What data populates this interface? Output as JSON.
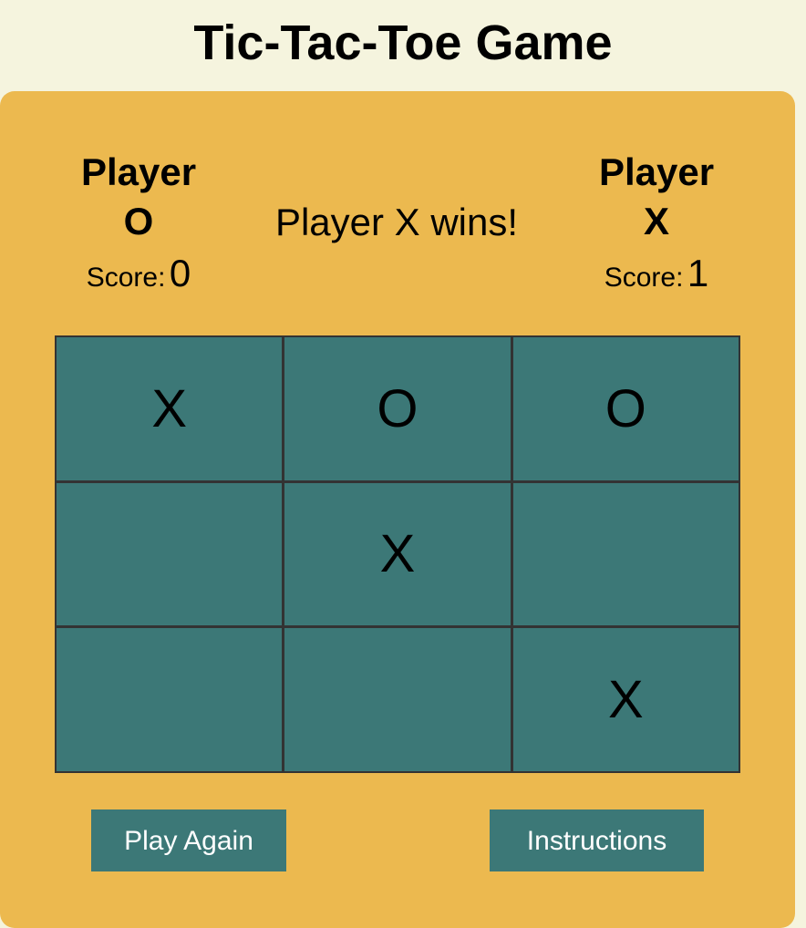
{
  "title": "Tic-Tac-Toe Game",
  "player_o": {
    "label": "Player",
    "symbol": "O",
    "score_label": "Score:",
    "score": "0"
  },
  "player_x": {
    "label": "Player",
    "symbol": "X",
    "score_label": "Score:",
    "score": "1"
  },
  "status": "Player X wins!",
  "board": [
    [
      "X",
      "O",
      "O"
    ],
    [
      "",
      "X",
      ""
    ],
    [
      "",
      "",
      "X"
    ]
  ],
  "buttons": {
    "play_again": "Play Again",
    "instructions": "Instructions"
  },
  "colors": {
    "background": "#f5f4de",
    "panel": "#ecb94f",
    "cell": "#3c7877",
    "button": "#3c7877"
  }
}
